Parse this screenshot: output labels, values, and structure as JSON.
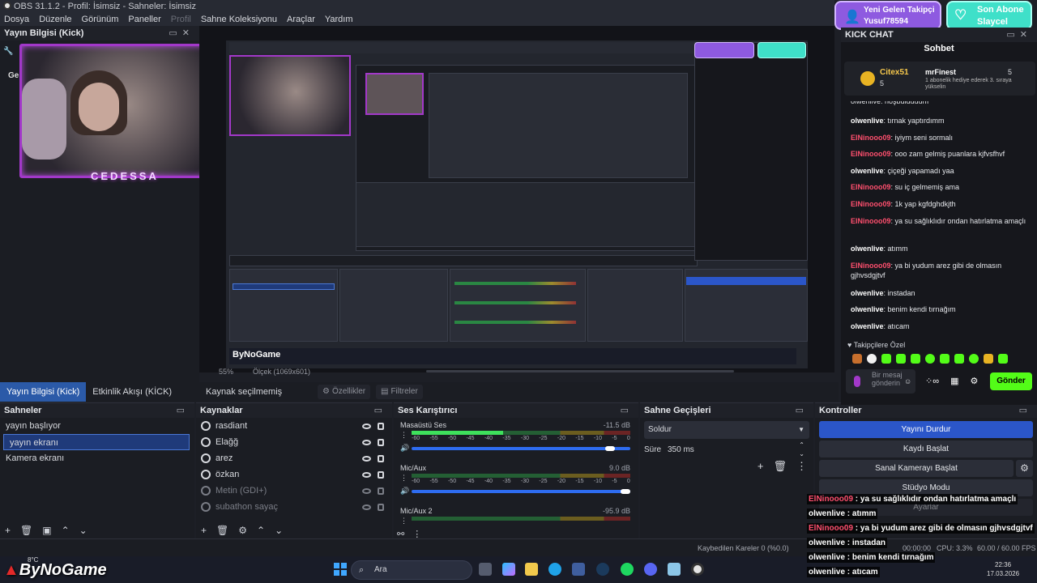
{
  "window": {
    "title": "OBS 31.1.2 - Profil: İsimsiz - Sahneler: İsimsiz"
  },
  "menu": [
    "Dosya",
    "Düzenle",
    "Görünüm",
    "Paneller",
    "Profil",
    "Sahne Koleksiyonu",
    "Araçlar",
    "Yardım"
  ],
  "stream_info_dock": {
    "title": "Yayın Bilgisi (Kick)",
    "cam_label": "CEDESSA",
    "partial_text": "Ge"
  },
  "preview": {
    "zoom": "55%",
    "scale_label": "Ölçek (1069x601)",
    "watermark": "ByNoGame"
  },
  "dock_tabs": [
    {
      "label": "Yayın Bilgisi (Kick)",
      "active": true
    },
    {
      "label": "Etkinlik Akışı (KİCK)",
      "active": false
    }
  ],
  "source_bar": {
    "no_source": "Kaynak seçilmemiş",
    "properties": "Özellikler",
    "filters": "Filtreler"
  },
  "scenes": {
    "title": "Sahneler",
    "items": [
      {
        "label": "yayın başlıyor",
        "selected": false
      },
      {
        "label": "yayın ekranı",
        "selected": true
      },
      {
        "label": "Kamera ekranı",
        "selected": false
      }
    ]
  },
  "sources": {
    "title": "Kaynaklar",
    "items": [
      {
        "label": "rasdiant",
        "dim": false
      },
      {
        "label": "Elağğ",
        "dim": false
      },
      {
        "label": "arez",
        "dim": false
      },
      {
        "label": "özkan",
        "dim": false
      },
      {
        "label": "Metin (GDI+)",
        "dim": true
      },
      {
        "label": "subathon sayaç",
        "dim": true
      }
    ]
  },
  "mixer": {
    "title": "Ses Karıştırıcı",
    "scale": [
      "-60",
      "-55",
      "-50",
      "-45",
      "-40",
      "-35",
      "-30",
      "-25",
      "-20",
      "-15",
      "-10",
      "-5",
      "0"
    ],
    "channels": [
      {
        "name": "Masaüstü Ses",
        "db": "-11.5 dB",
        "level": 0.42,
        "volume": 0.93
      },
      {
        "name": "Mic/Aux",
        "db": "9.0 dB",
        "level": 0.0,
        "volume": 1.0
      },
      {
        "name": "Mic/Aux 2",
        "db": "-95.9 dB",
        "level": 0.0,
        "volume": 1.0
      }
    ]
  },
  "transitions": {
    "title": "Sahne Geçişleri",
    "selected": "Soldur",
    "duration_label": "Süre",
    "duration_value": "350 ms"
  },
  "controls": {
    "title": "Kontroller",
    "stop_stream": "Yayını Durdur",
    "start_recording": "Kaydı Başlat",
    "virtual_camera": "Sanal Kamerayı Başlat",
    "studio_mode": "Stüdyo Modu",
    "settings": "Ayarlar"
  },
  "statusbar": {
    "dropped": "Kaybedilen Kareler 0 (%0.0)",
    "time": "00:00:00",
    "cpu": "CPU: 3.3%",
    "fps": "60.00 / 60.00 FPS"
  },
  "notifications": {
    "follow_title": "Yeni Gelen Takipçi",
    "follow_user": "Yusuf78594",
    "sub_title": "Son Abone",
    "sub_user": "Slaycel"
  },
  "chat": {
    "dock_title": "KICK CHAT",
    "header": "Sohbet",
    "pinned_user1": "Citex51",
    "pinned_count1": "5",
    "pinned_user2": "mrFinest",
    "pinned_count2": "5",
    "pinned_text": "1 abonelik hediye ederek 3. sıraya yükselin",
    "partial_top": "olwenlive: hoşbulduuum",
    "messages": [
      {
        "user": "olwenlive",
        "text": "tırnak yaptırdımm",
        "red": false
      },
      {
        "user": "ElNinooo09",
        "text": "iyiym seni sormalı",
        "red": true
      },
      {
        "user": "ElNinooo09",
        "text": "ooo zam gelmiş puanlara kjfvsfhvf",
        "red": true
      },
      {
        "user": "olwenlive",
        "text": "çiçeği yapamadı yaa",
        "red": false
      },
      {
        "user": "ElNinooo09",
        "text": "su iç gelmemiş ama",
        "red": true
      },
      {
        "user": "ElNinooo09",
        "text": "1k yap kgfdghdkjth",
        "red": true
      },
      {
        "user": "ElNinooo09",
        "text": "ya su sağlıklıdır ondan hatırlatma amaçlı",
        "red": true
      },
      {
        "user": "olwenlive",
        "text": "atımm",
        "red": false
      },
      {
        "user": "ElNinooo09",
        "text": "ya bi yudum arez gibi de olmasın gjhvsdgjtvf",
        "red": true
      },
      {
        "user": "olwenlive",
        "text": "instadan",
        "red": false
      },
      {
        "user": "olwenlive",
        "text": "benim kendi tırnağım",
        "red": false
      },
      {
        "user": "olwenlive",
        "text": "atıcam",
        "red": false
      }
    ],
    "followers_only": "Takipçilere Özel",
    "input_placeholder": "Bir mesaj gönderin",
    "send": "Gönder"
  },
  "overlay_chat": [
    {
      "user": "ElNinooo09",
      "text": " : ya su sağlıklıdır ondan hatırlatma amaçlı",
      "red": true
    },
    {
      "user": "olwenlive",
      "text": " : atımm",
      "red": false
    },
    {
      "user": "ElNinooo09",
      "text": " : ya bi yudum arez gibi de olmasın gjhvsdgjtvf",
      "red": true
    },
    {
      "user": "olwenlive",
      "text": " : instadan",
      "red": false
    },
    {
      "user": "olwenlive",
      "text": " : benim kendi tırnağım",
      "red": false
    },
    {
      "user": "olwenlive",
      "text": " : atıcam",
      "red": false
    }
  ],
  "taskbar": {
    "search": "Ara",
    "temp": "8°C",
    "clock_time": "22:36",
    "clock_date": "17.03.2026",
    "watermark": "ByNoGame"
  }
}
